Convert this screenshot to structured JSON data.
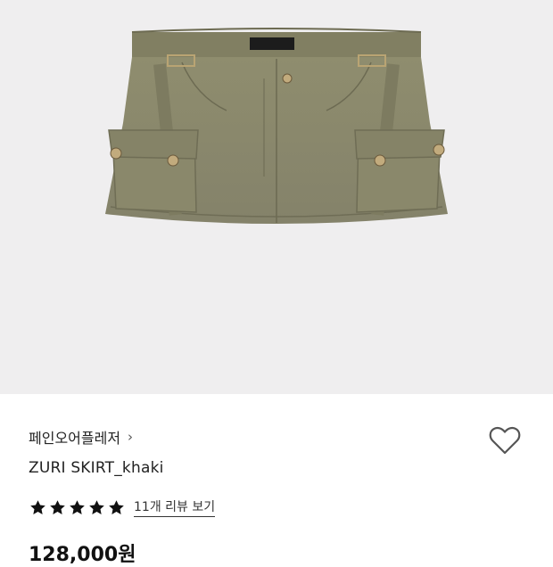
{
  "product": {
    "brand": "페인오어플레저",
    "brand_chevron": "›",
    "name": "ZURI SKIRT_khaki",
    "rating_stars": 5,
    "reviews_link": "11개 리뷰 보기",
    "price": "128,000원",
    "wishlist_icon": "heart-outline-icon",
    "image_icon": "khaki-cargo-mini-skirt"
  },
  "colors": {
    "image_bg": "#efeeef",
    "skirt_khaki": "#8a8a6a",
    "star": "#111111"
  }
}
